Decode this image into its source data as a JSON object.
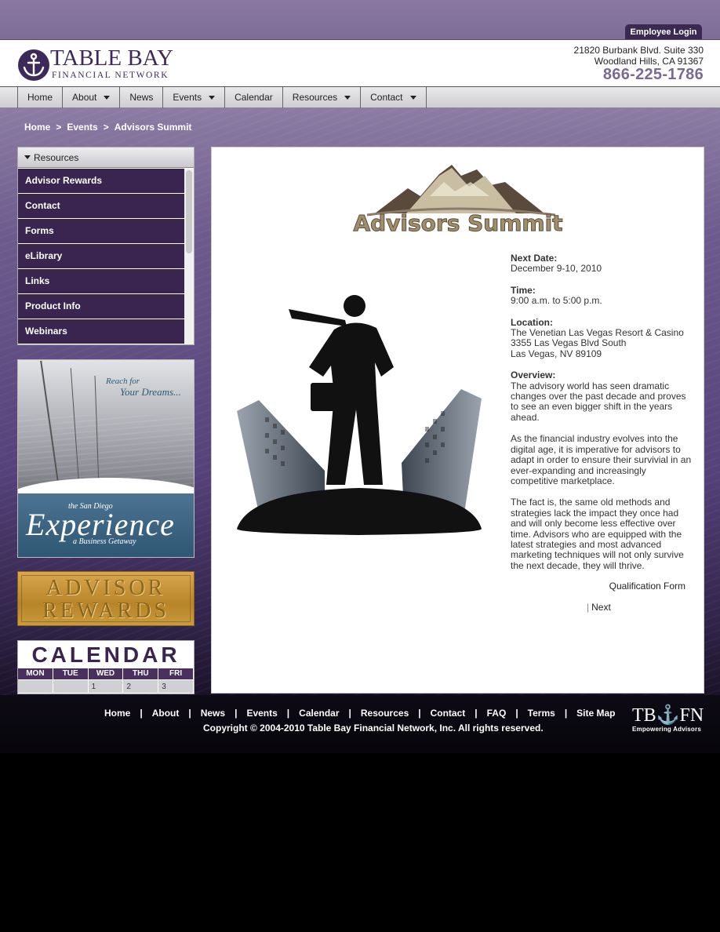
{
  "header": {
    "employee_login": "Employee Login",
    "logo_main": "TABLE BAY",
    "logo_sub": "FINANCIAL NETWORK",
    "address_line1": "21820 Burbank Blvd. Suite 330",
    "address_line2": "Woodland Hills, CA 91367",
    "phone": "866-225-1786"
  },
  "nav": {
    "items": [
      {
        "label": "Home"
      },
      {
        "label": "About"
      },
      {
        "label": "News"
      },
      {
        "label": "Events"
      },
      {
        "label": "Calendar"
      },
      {
        "label": "Resources"
      },
      {
        "label": "Contact"
      }
    ]
  },
  "breadcrumb": {
    "home": "Home",
    "sep": ">",
    "events": "Events",
    "current": "Advisors Summit"
  },
  "sidebar": {
    "resources_title": "Resources",
    "items": [
      {
        "label": "Advisor Rewards"
      },
      {
        "label": "Contact"
      },
      {
        "label": "Forms"
      },
      {
        "label": "eLibrary"
      },
      {
        "label": "Links"
      },
      {
        "label": "Product Info"
      },
      {
        "label": "Webinars"
      }
    ],
    "promo_sd": {
      "reach1": "Reach for",
      "reach2": "Your Dreams...",
      "the": "the San Diego",
      "experience": "Experience",
      "getaway": "a Business Getaway"
    },
    "promo_rewards": {
      "line1": "ADVISOR",
      "line2": "REWARDS"
    },
    "promo_calendar": {
      "title": "CALENDAR",
      "days": [
        "MON",
        "TUE",
        "WED",
        "THU",
        "FRI"
      ],
      "nums": [
        "",
        "",
        "1",
        "2",
        "3"
      ]
    }
  },
  "main": {
    "summit_title": "Advisors Summit",
    "next_date_label": "Next Date:",
    "next_date": "December 9-10, 2010",
    "time_label": "Time:",
    "time": "9:00 a.m. to 5:00 p.m.",
    "location_label": "Location:",
    "location_line1": "The Venetian Las Vegas Resort & Casino",
    "location_line2": "3355 Las Vegas Blvd South",
    "location_line3": "Las Vegas, NV 89109",
    "overview_label": "Overview:",
    "overview_p1": "The advisory world has seen dramatic changes over the past decade and proves to see an even bigger shift in the years ahead.",
    "overview_p2": "As the financial industry evolves into the digital age, it is imperative for advisors to adapt in order to ensure their survivial in an ever-expanding and increasingly competitive marketplace.",
    "overview_p3": "The fact is, the same old methods and strategies lack the impact they once had and will only become less effective over time. Advisors who are equipped with the latest strategies and most advanced marketing techniques will not only survive the next decade, they will thrive.",
    "qualification_form": "Qualification Form",
    "next_sep": "|",
    "next": "Next"
  },
  "footer": {
    "links": [
      "Home",
      "About",
      "News",
      "Events",
      "Calendar",
      "Resources",
      "Contact",
      "FAQ",
      "Terms",
      "Site Map"
    ],
    "sep": "|",
    "copyright": "Copyright © 2004-2010 Table Bay Financial Network, Inc. All rights reserved.",
    "logo_main": "TB⚓FN",
    "logo_tagline": "Empowering Advisors"
  }
}
